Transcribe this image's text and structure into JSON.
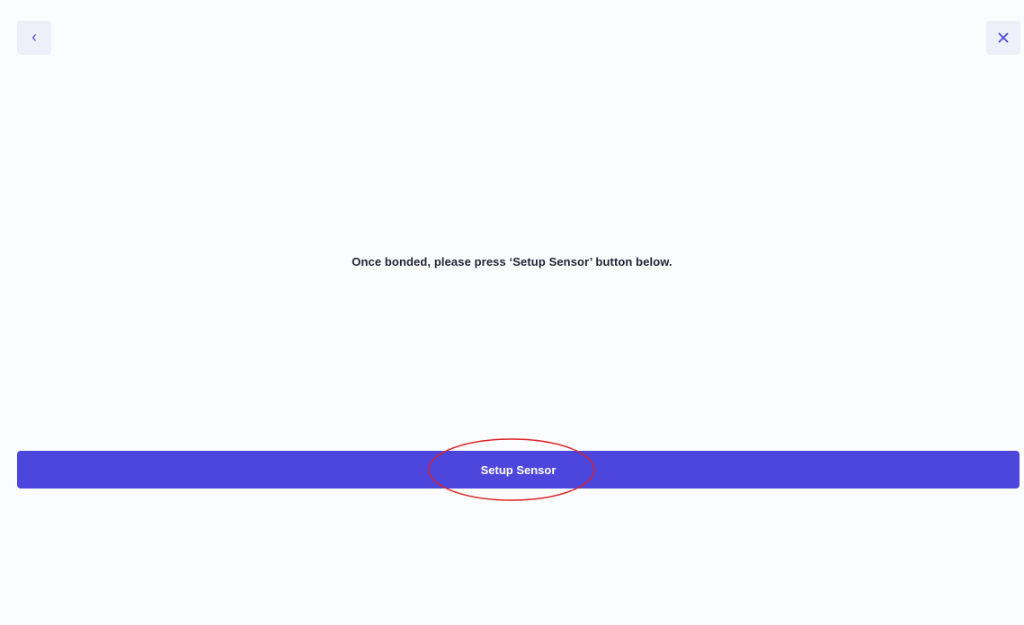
{
  "header": {
    "back_icon": "chevron-left-icon",
    "close_icon": "close-icon",
    "icon_color": "#4c46dd",
    "icon_bg": "#eef0f9"
  },
  "main": {
    "message": "Once bonded, please press ‘Setup Sensor’ button below."
  },
  "footer": {
    "primary_button_label": "Setup Sensor",
    "primary_color": "#4c46dd"
  },
  "annotation": {
    "highlight_color": "#e02020",
    "highlight_target": "setup-sensor-button"
  }
}
